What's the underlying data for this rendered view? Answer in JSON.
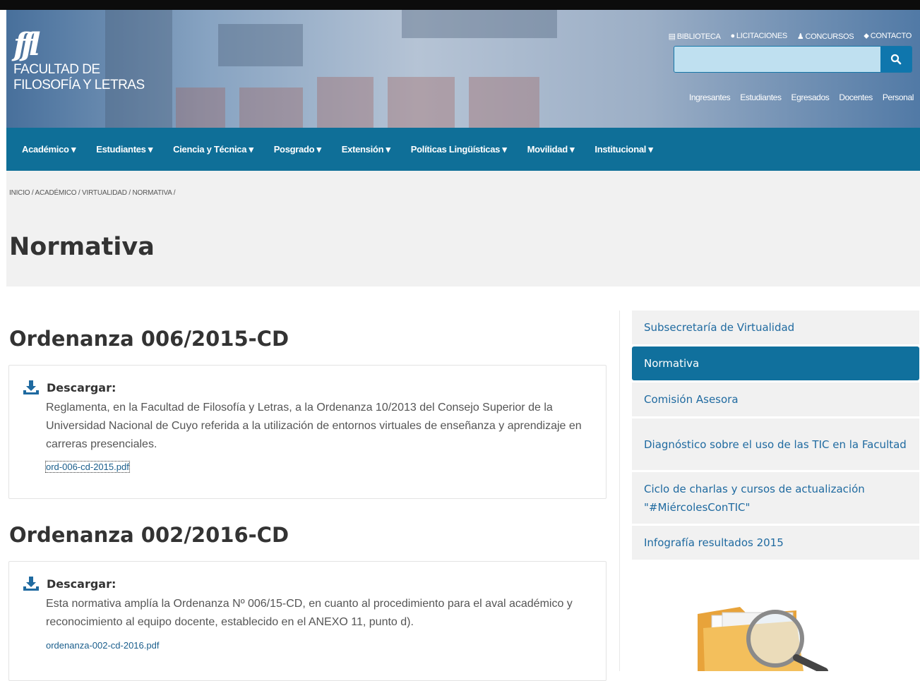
{
  "header": {
    "logo_mark": "ffl",
    "logo_line1": "FACULTAD DE",
    "logo_line2": "FILOSOFÍA Y LETRAS",
    "utility_links": [
      {
        "icon": "book-icon",
        "glyph": "▤",
        "label": "BIBLIOTECA"
      },
      {
        "icon": "globe-icon",
        "glyph": "●",
        "label": "LICITACIONES"
      },
      {
        "icon": "user-icon",
        "glyph": "♟",
        "label": "CONCURSOS"
      },
      {
        "icon": "map-marker-icon",
        "glyph": "⬥",
        "label": "CONTACTO"
      }
    ],
    "search": {
      "placeholder": "",
      "value": ""
    },
    "audience_links": [
      "Ingresantes",
      "Estudiantes",
      "Egresados",
      "Docentes",
      "Personal"
    ]
  },
  "nav": [
    {
      "label": "Académico ▾"
    },
    {
      "label": "Estudiantes ▾"
    },
    {
      "label": "Ciencia y Técnica ▾"
    },
    {
      "label": "Posgrado ▾"
    },
    {
      "label": "Extensión ▾"
    },
    {
      "label": "Políticas Lingüísticas ▾"
    },
    {
      "label": "Movilidad ▾"
    },
    {
      "label": "Institucional ▾"
    }
  ],
  "breadcrumb": "INICIO / ACADÉMICO / VIRTUALIDAD / NORMATIVA /",
  "page_title": "Normativa",
  "documents": [
    {
      "title": "Ordenanza 006/2015-CD",
      "download_label": "Descargar:",
      "description": "Reglamenta, en la Facultad de Filosofía y Letras, a la Ordenanza 10/2013 del Consejo Superior de la Universidad Nacional de Cuyo referida a la utilización de entornos virtuales de enseñanza y aprendizaje en carreras presenciales.",
      "file": "ord-006-cd-2015.pdf"
    },
    {
      "title": "Ordenanza 002/2016-CD",
      "download_label": "Descargar:",
      "description": "Esta normativa amplía la Ordenanza Nº 006/15-CD, en cuanto al procedimiento para el aval académico y reconocimiento al equipo docente, establecido en el ANEXO 11, punto d).",
      "file": "ordenanza-002-cd-2016.pdf"
    }
  ],
  "sidebar": [
    {
      "label": "Subsecretaría de Virtualidad",
      "active": false
    },
    {
      "label": "Normativa",
      "active": true
    },
    {
      "label": "Comisión Asesora",
      "active": false
    },
    {
      "label": "Diagnóstico sobre el uso de las TIC en la Facultad",
      "active": false
    },
    {
      "label": "Ciclo de charlas y cursos de actualización \"#MiércolesConTIC\"",
      "active": false
    },
    {
      "label": "Infografía resultados 2015",
      "active": false
    }
  ],
  "colors": {
    "nav_bg": "#0f6f98",
    "active_bg": "#10709d",
    "link": "#1f6aa0"
  }
}
